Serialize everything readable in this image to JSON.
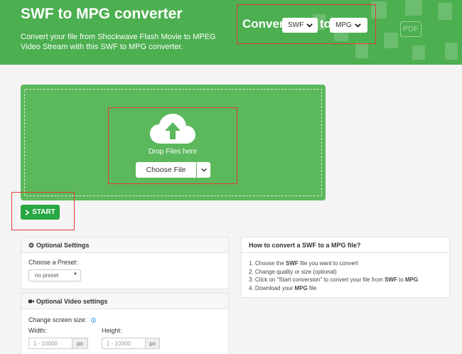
{
  "header": {
    "title": "SWF to MPG converter",
    "description": "Convert your file from Shockwave Flash Movie to MPEG Video Stream with this SWF to MPG converter.",
    "convert_label": "Convert",
    "to_label": "to",
    "from_format": "SWF",
    "to_format": "MPG",
    "bg_icon_label": "PDF"
  },
  "dropzone": {
    "label": "Drop Files here",
    "choose_button": "Choose File"
  },
  "start_button": "START",
  "optional_settings": {
    "title": "Optional Settings",
    "preset_label": "Choose a Preset:",
    "preset_value": "no preset"
  },
  "video_settings": {
    "title": "Optional Video settings",
    "screen_size_label": "Change screen size:",
    "width_label": "Width:",
    "height_label": "Height:",
    "width_placeholder": "1 - 10000",
    "height_placeholder": "1 - 10000",
    "unit": "px"
  },
  "howto": {
    "title": "How to convert a SWF to a MPG file?",
    "steps": [
      [
        "1. Choose the ",
        "SWF",
        " file you want to convert",
        "",
        ""
      ],
      [
        "2. Change quality or size (optional)",
        "",
        "",
        "",
        ""
      ],
      [
        "3. Click on \"Start conversion\" to convert your file from ",
        "SWF",
        " to ",
        "MPG",
        ""
      ],
      [
        "4. Download your ",
        "MPG",
        " file",
        "",
        ""
      ]
    ]
  },
  "colors": {
    "header_green": "#4caf50",
    "dropzone_green": "#5cb85c",
    "start_green": "#28a745",
    "highlight_red": "#e53935"
  }
}
